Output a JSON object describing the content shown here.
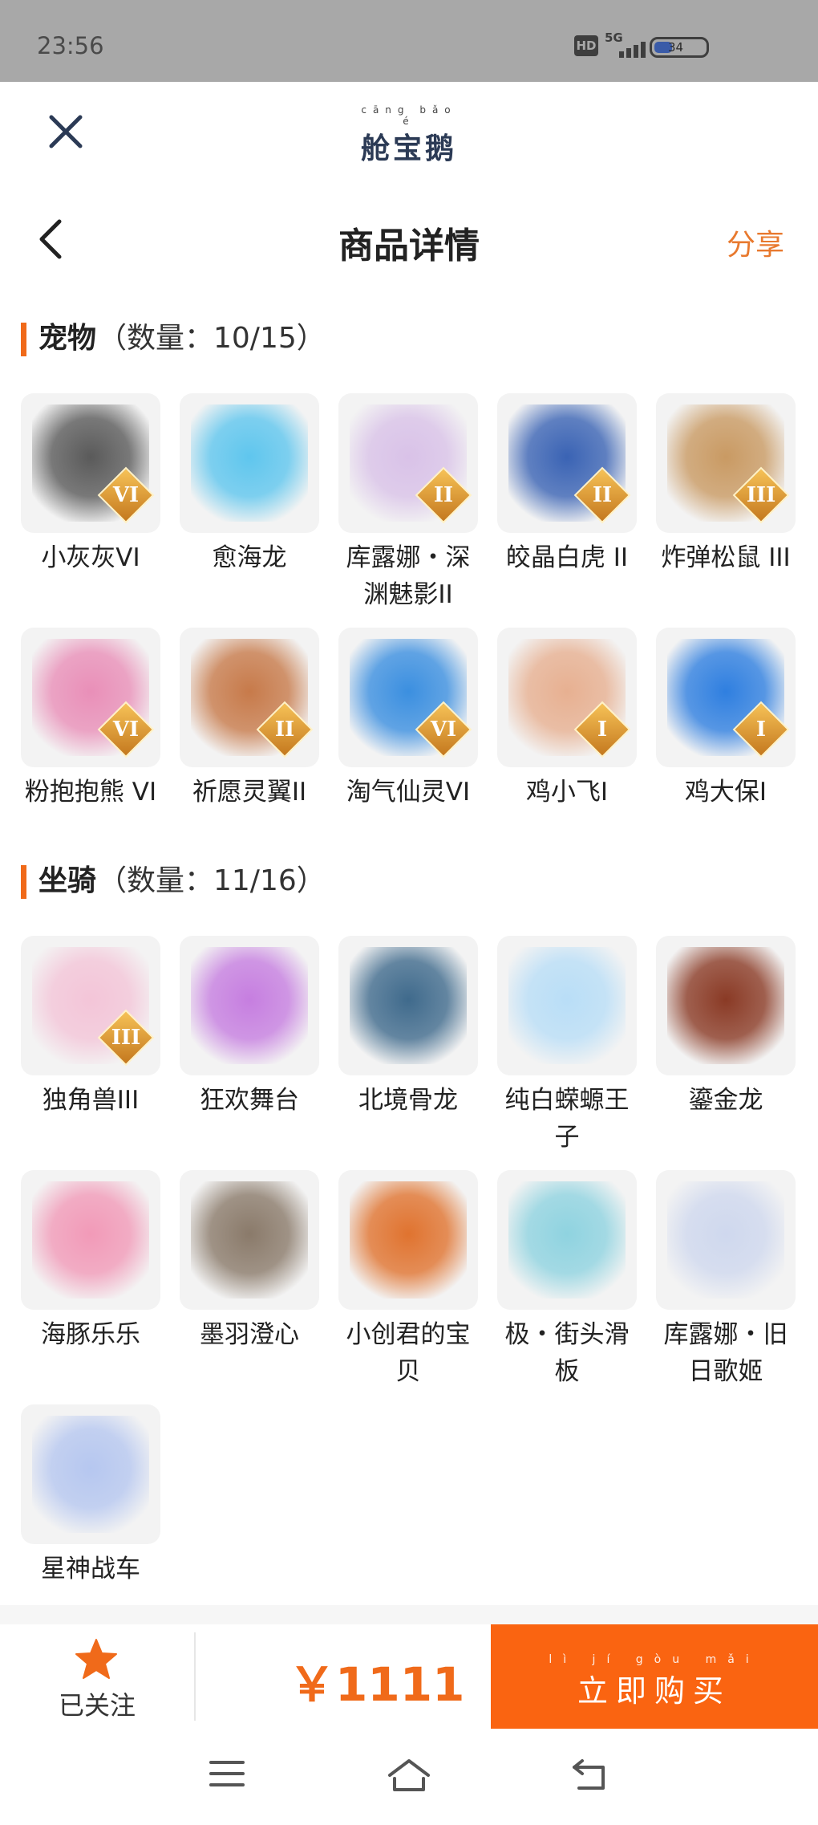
{
  "status": {
    "time": "23:56",
    "hd": "HD",
    "network": "5G",
    "battery": "34"
  },
  "topnav": {
    "logo_pinyin": "cāng bǎo é",
    "logo_text": "舱宝鹅"
  },
  "header": {
    "title": "商品详情",
    "share": "分享"
  },
  "pets": {
    "name": "宠物",
    "count": "（数量：10/15）",
    "items": [
      {
        "label": "小灰灰VI",
        "badge": "VI",
        "color": "#5a5a5a"
      },
      {
        "label": "愈海龙",
        "badge": "",
        "color": "#5fc6ee"
      },
      {
        "label": "库露娜・深渊魅影II",
        "badge": "II",
        "color": "#d9c2e8"
      },
      {
        "label": "皎晶白虎 II",
        "badge": "II",
        "color": "#3a63b4"
      },
      {
        "label": "炸弹松鼠 III",
        "badge": "III",
        "color": "#c99a63"
      },
      {
        "label": "粉抱抱熊 VI",
        "badge": "VI",
        "color": "#e98fb8"
      },
      {
        "label": "祈愿灵翼II",
        "badge": "II",
        "color": "#c77a4a"
      },
      {
        "label": "淘气仙灵VI",
        "badge": "VI",
        "color": "#3b8fe0"
      },
      {
        "label": "鸡小飞I",
        "badge": "I",
        "color": "#e7b091"
      },
      {
        "label": "鸡大保I",
        "badge": "I",
        "color": "#2f7fe0"
      }
    ]
  },
  "mounts": {
    "name": "坐骑",
    "count": "（数量：11/16）",
    "items": [
      {
        "label": "独角兽III",
        "badge": "III",
        "color": "#f3c5d8"
      },
      {
        "label": "狂欢舞台",
        "badge": "",
        "color": "#c67ee0"
      },
      {
        "label": "北境骨龙",
        "badge": "",
        "color": "#3f6a8c"
      },
      {
        "label": "纯白蝾螈王子",
        "badge": "",
        "color": "#b9def7"
      },
      {
        "label": "鎏金龙",
        "badge": "",
        "color": "#8a3a25"
      },
      {
        "label": "海豚乐乐",
        "badge": "",
        "color": "#f29ab8"
      },
      {
        "label": "墨羽澄心",
        "badge": "",
        "color": "#8a7a6a"
      },
      {
        "label": "小创君的宝贝",
        "badge": "",
        "color": "#e0732f"
      },
      {
        "label": "极・街头滑板",
        "badge": "",
        "color": "#8fd3e0"
      },
      {
        "label": "库露娜・旧日歌姬",
        "badge": "",
        "color": "#cfd8ee"
      },
      {
        "label": "星神战车",
        "badge": "",
        "color": "#b6c7f0"
      }
    ]
  },
  "bottom": {
    "follow_label": "已关注",
    "price": "￥1111",
    "buy_pinyin": "lì jí gòu mǎi",
    "buy_label": "立即购买"
  },
  "colors": {
    "accent": "#fa6411",
    "share": "#e8792e",
    "badge": "#d99a33"
  }
}
